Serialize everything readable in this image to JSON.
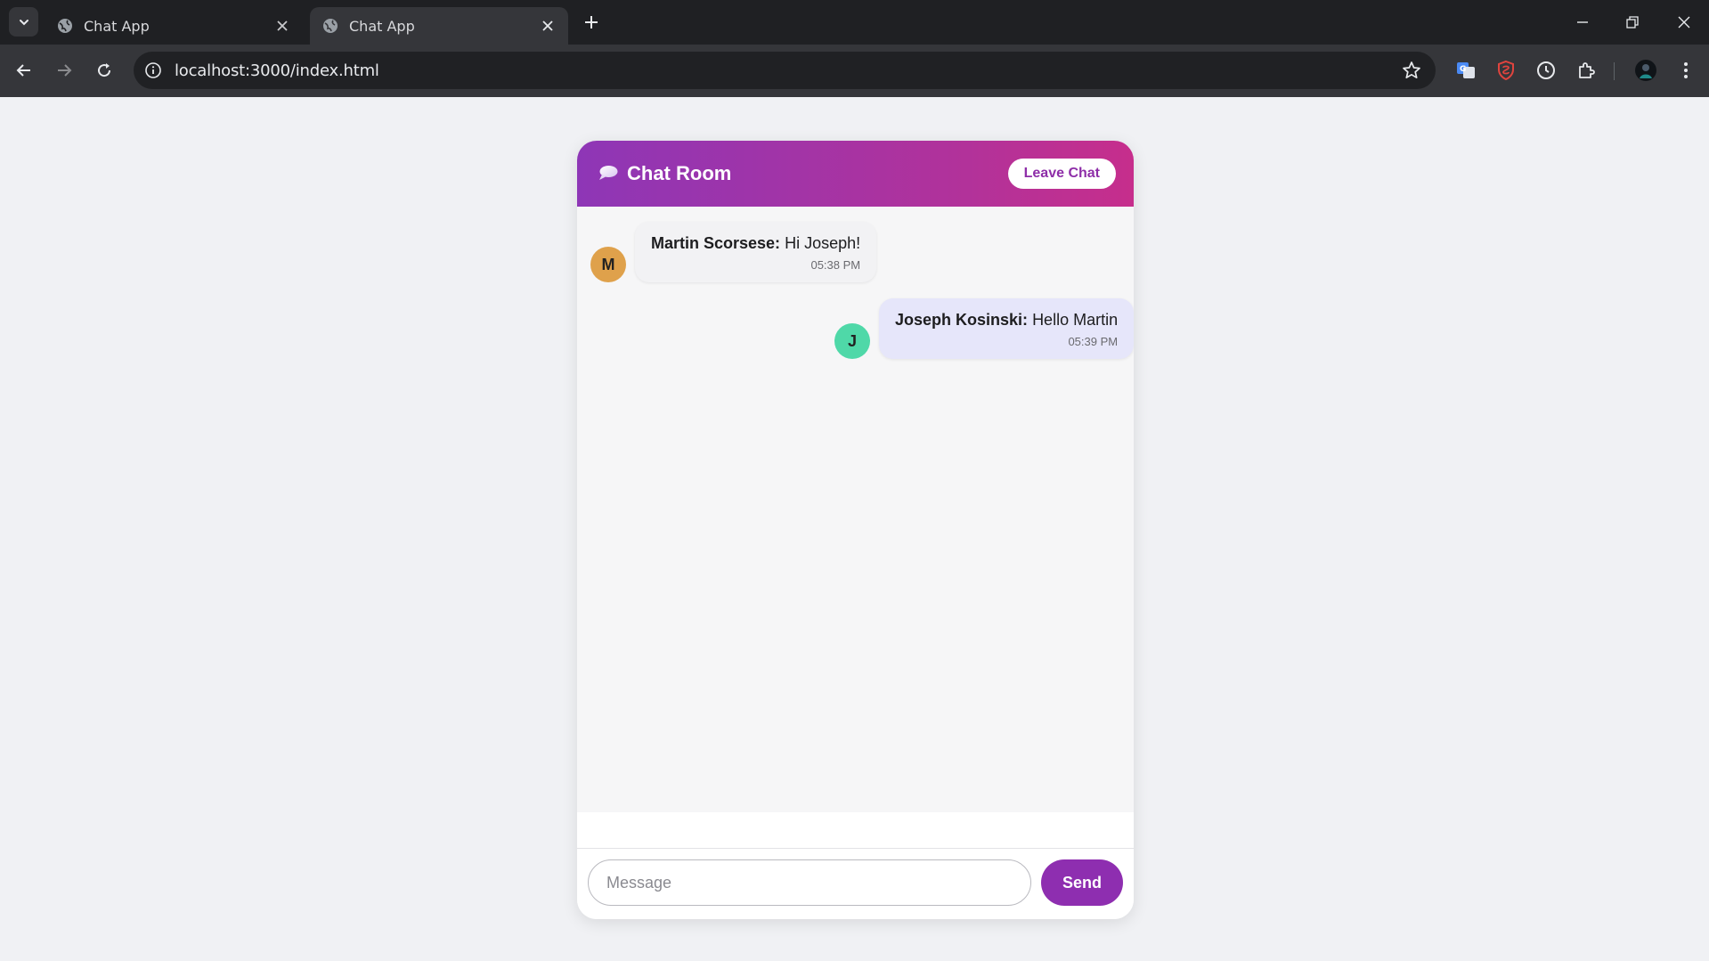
{
  "browser": {
    "tabs": [
      {
        "title": "Chat App",
        "active": false
      },
      {
        "title": "Chat App",
        "active": true
      }
    ],
    "url": "localhost:3000/index.html"
  },
  "chat": {
    "header": {
      "icon": "speech-bubble-icon",
      "title": "Chat Room",
      "leave_label": "Leave Chat"
    },
    "messages": [
      {
        "avatar_letter": "M",
        "avatar_color": "#dfa14b",
        "sender": "Martin Scorsese:",
        "text": "Hi Joseph!",
        "time": "05:38 PM",
        "side": "left"
      },
      {
        "avatar_letter": "J",
        "avatar_color": "#4fd8a8",
        "sender": "Joseph Kosinski:",
        "text": "Hello Martin",
        "time": "05:39 PM",
        "side": "right"
      }
    ],
    "composer": {
      "placeholder": "Message",
      "value": "",
      "send_label": "Send"
    }
  },
  "colors": {
    "accent": "#8e2eb0",
    "header_gradient_start": "#8e36b6",
    "header_gradient_end": "#c62e8c"
  }
}
